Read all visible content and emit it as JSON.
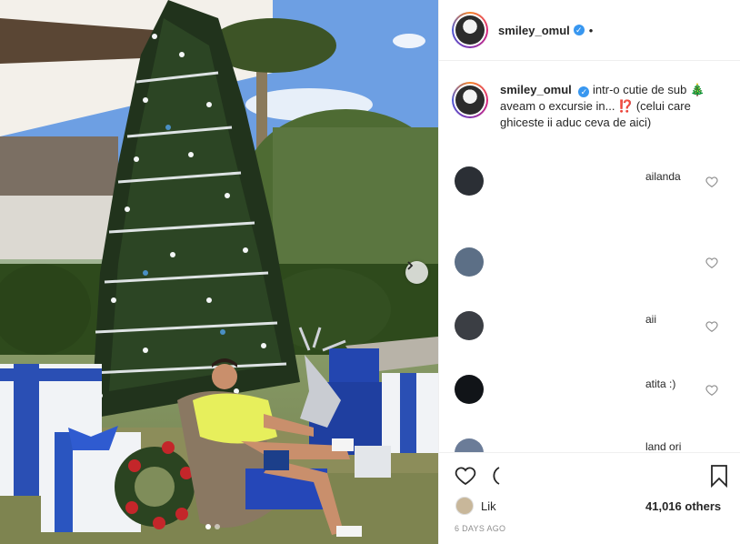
{
  "post": {
    "username": "smiley_omul",
    "verified_mark": "✓",
    "header_dot": "•"
  },
  "caption": {
    "username": "smiley_omul",
    "text_line1": "intr-o cutie de sub",
    "tree_emoji": "🎄",
    "text_line2": "aveam o excursie in... ⁉️ (celui care",
    "text_line3": "ghiceste ii aduc ceva de aici)"
  },
  "comments": [
    {
      "text": "ailanda",
      "avatar_color": "#2b2f35"
    },
    {
      "text": "",
      "avatar_color": "#5c6f86"
    },
    {
      "text": "aii",
      "avatar_color": "#3b3e44"
    },
    {
      "text": "atita :)",
      "avatar_color": "#111418"
    },
    {
      "text": "land ori",
      "avatar_color": "#6b7c98"
    }
  ],
  "icons": {
    "next": "chevron-right-icon",
    "like": "heart-outline-icon",
    "comment": "comment-bubble-icon",
    "save": "bookmark-icon",
    "comment_like": "small-heart-icon"
  },
  "likes": {
    "partial_label": "Lik",
    "count_label": "41,016 others"
  },
  "timestamp": "6 DAYS AGO",
  "carousel": {
    "slides": 2,
    "active_slide": 1
  }
}
